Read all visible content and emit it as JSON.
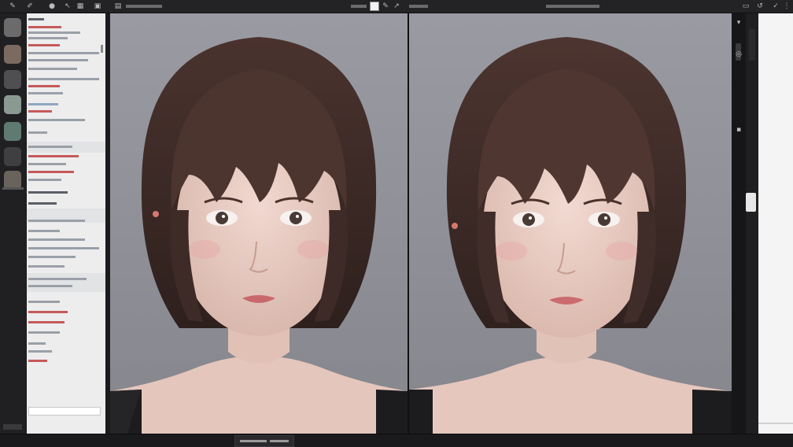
{
  "app": {
    "accent": "#c65a5a",
    "canvas_bg": "#919199"
  },
  "topbar": {
    "tools": [
      "brush-icon",
      "pen-icon",
      "circle-icon",
      "pin-icon",
      "grid-icon",
      "square-icon",
      "menu-icon"
    ]
  }
}
